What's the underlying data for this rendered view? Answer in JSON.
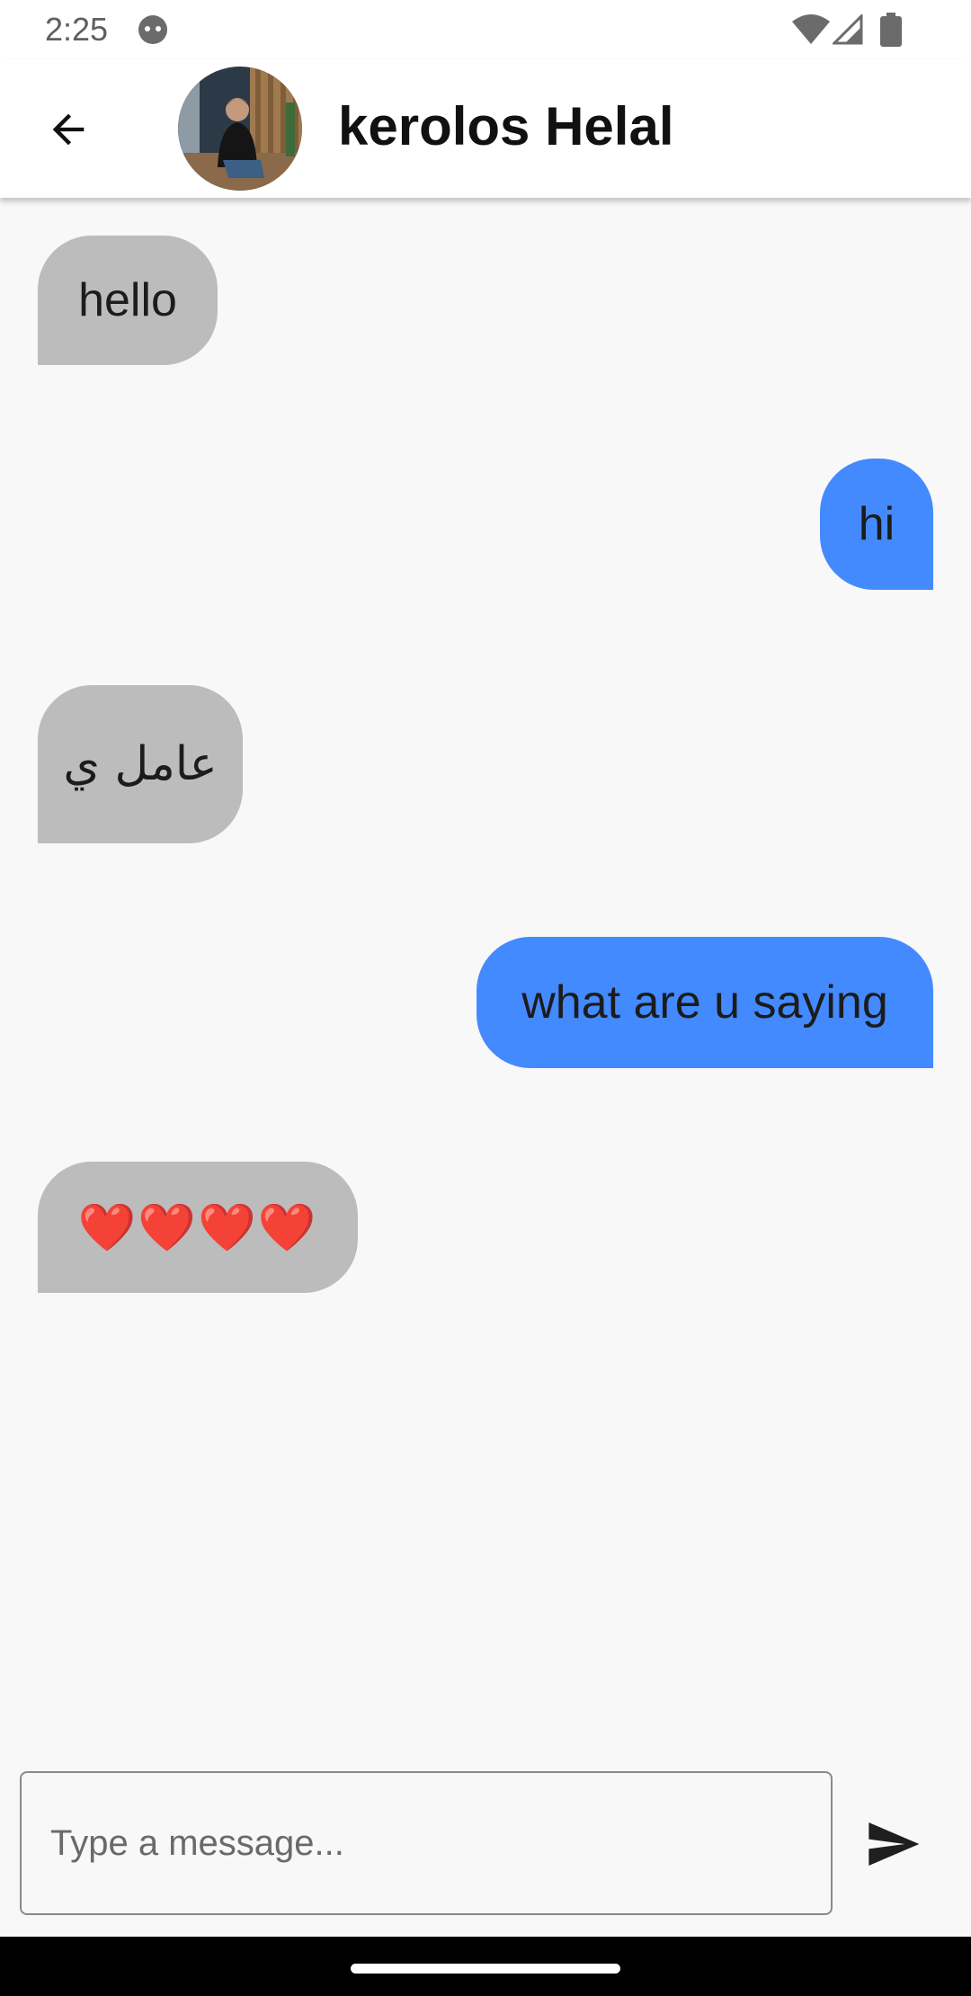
{
  "status_bar": {
    "time": "2:25",
    "icons": [
      "android-face-icon",
      "wifi-icon",
      "cellular-signal-icon",
      "battery-icon"
    ]
  },
  "app_bar": {
    "back_icon": "arrow-back-icon",
    "contact_name": "kerolos Helal"
  },
  "messages": [
    {
      "direction": "incoming",
      "text": "hello"
    },
    {
      "direction": "outgoing",
      "text": "hi"
    },
    {
      "direction": "incoming",
      "text": "عامل ي"
    },
    {
      "direction": "outgoing",
      "text": "what are u saying"
    },
    {
      "direction": "incoming",
      "text": "❤️❤️❤️❤️"
    }
  ],
  "composer": {
    "placeholder": "Type a message...",
    "value": "",
    "send_icon": "send-icon"
  },
  "colors": {
    "incoming_bubble": "#bcbcbc",
    "outgoing_bubble": "#448aff",
    "background": "#f8f8f8"
  }
}
